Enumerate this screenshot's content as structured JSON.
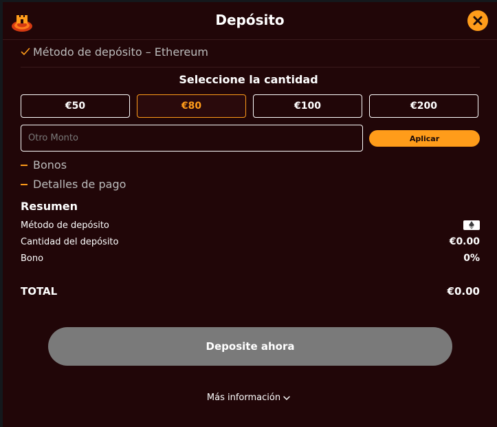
{
  "header": {
    "title": "Depósito"
  },
  "method": {
    "label": "Método de depósito – Ethereum"
  },
  "amount_section": {
    "title": "Seleccione la cantidad",
    "amounts": [
      "€50",
      "€80",
      "€100",
      "€200"
    ],
    "selected_index": 1,
    "other_placeholder": "Otro Monto",
    "apply_label": "Aplicar"
  },
  "collapsibles": {
    "bonus_label": "Bonos",
    "payment_details_label": "Detalles de pago"
  },
  "summary": {
    "title": "Resumen",
    "method_label": "Método de depósito",
    "amount_label": "Cantidad del depósito",
    "amount_value": "€0.00",
    "bonus_label": "Bono",
    "bonus_value": "0%",
    "total_label": "TOTAL",
    "total_value": "€0.00"
  },
  "actions": {
    "deposit_label": "Deposite ahora",
    "more_info_label": "Más información"
  },
  "colors": {
    "background": "#210608",
    "accent": "#ff9c1a",
    "disabled_button": "#7a7a7a"
  },
  "icons": {
    "logo": "castle-logo-icon",
    "close": "close-icon",
    "check": "check-icon",
    "dash": "dash-icon",
    "method": "ethereum-icon",
    "chevron": "chevron-down-icon"
  }
}
